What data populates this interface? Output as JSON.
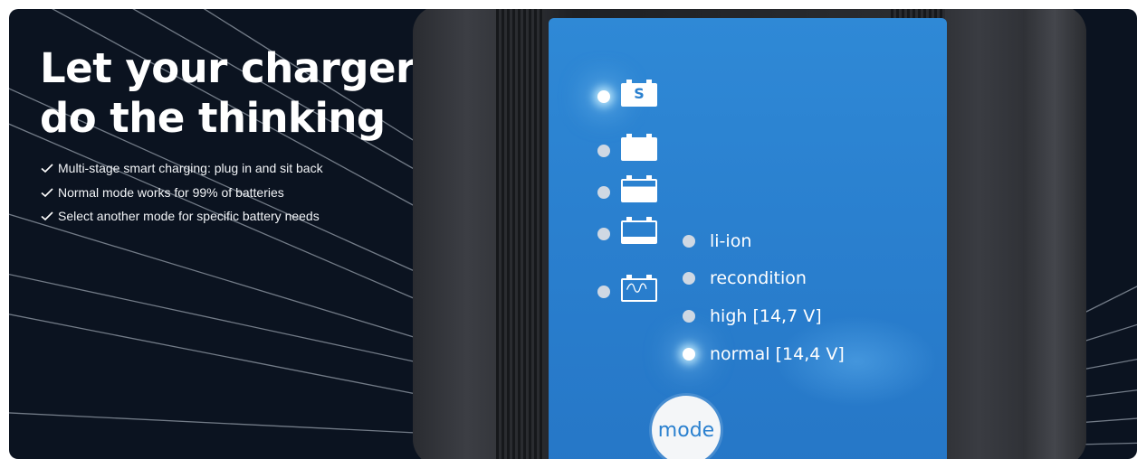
{
  "hero": {
    "title_line1": "Let your charger",
    "title_line2": "do the thinking",
    "features": [
      "Multi-stage smart charging: plug in and sit back",
      "Normal mode works for 99% of batteries",
      "Select another mode for specific battery needs"
    ],
    "feature_icon": "checkmark-icon"
  },
  "charger": {
    "status_leds": [
      {
        "icon": "battery-standby-icon",
        "state": "on",
        "symbol": "S"
      },
      {
        "icon": "battery-full-icon",
        "state": "off"
      },
      {
        "icon": "battery-absorption-icon",
        "state": "off"
      },
      {
        "icon": "battery-bulk-icon",
        "state": "off"
      },
      {
        "icon": "battery-recondition-icon",
        "state": "off"
      }
    ],
    "modes": [
      {
        "label": "li-ion",
        "state": "off"
      },
      {
        "label": "recondition",
        "state": "off"
      },
      {
        "label": "high [14,7 V]",
        "state": "off"
      },
      {
        "label": "normal [14,4 V]",
        "state": "on"
      }
    ],
    "mode_button_label": "mode"
  },
  "colors": {
    "background": "#0b1320",
    "panel_blue": "#2a80cf",
    "housing": "#2c2e33",
    "text": "#ffffff"
  }
}
